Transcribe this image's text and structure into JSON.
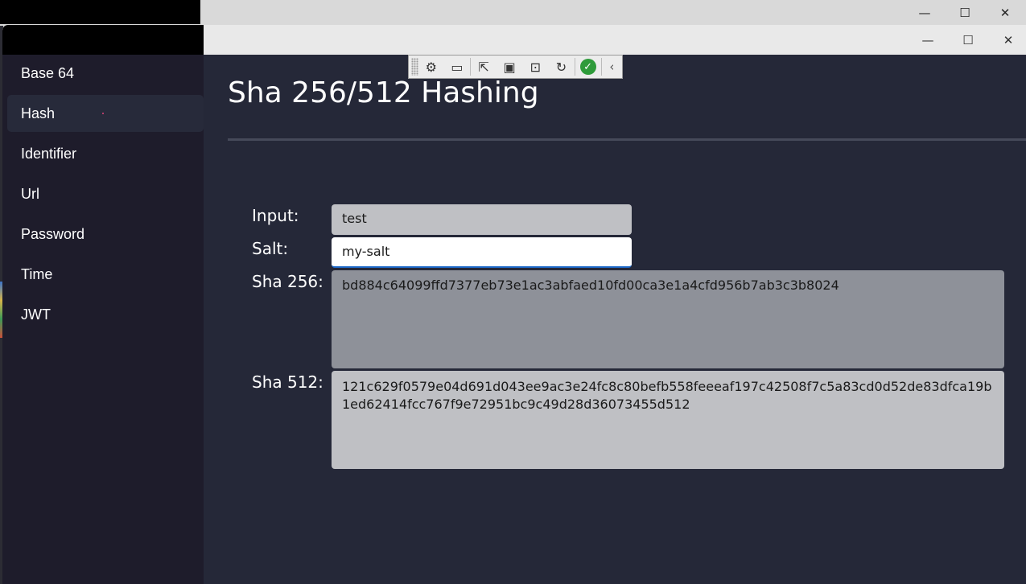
{
  "outer_window": {
    "minimize_glyph": "—",
    "maximize_glyph": "☐",
    "close_glyph": "✕"
  },
  "window": {
    "minimize_glyph": "—",
    "maximize_glyph": "☐",
    "close_glyph": "✕"
  },
  "sidebar": {
    "items": [
      {
        "label": "Base 64",
        "selected": false
      },
      {
        "label": "Hash",
        "selected": true
      },
      {
        "label": "Identifier",
        "selected": false
      },
      {
        "label": "Url",
        "selected": false
      },
      {
        "label": "Password",
        "selected": false
      },
      {
        "label": "Time",
        "selected": false
      },
      {
        "label": "JWT",
        "selected": false
      }
    ]
  },
  "main": {
    "title": "Sha 256/512 Hashing",
    "input": {
      "label": "Input:",
      "value": "test"
    },
    "salt": {
      "label": "Salt:",
      "value": "my-salt"
    },
    "sha256": {
      "label": "Sha 256:",
      "value": "bd884c64099ffd7377eb73e1ac3abfaed10fd00ca3e1a4cfd956b7ab3c3b8024"
    },
    "sha512": {
      "label": "Sha 512:",
      "value": "121c629f0579e04d691d043ee9ac3e24fc8c80befb558feeeaf197c42508f7c5a83cd0d52de83dfca19b1ed62414fcc767f9e72951bc9c49d28d36073455d512"
    }
  },
  "debug_toolbar": {
    "icons": [
      "live-visual-tree-icon",
      "record-icon",
      "select-element-icon",
      "display-layout-adorners-icon",
      "track-focus-icon",
      "hot-reload-icon",
      "binding-failures-ok-icon",
      "collapse-chevron-icon"
    ],
    "glyphs": {
      "live_visual_tree": "⚙",
      "record": "▭",
      "select_element": "⇱",
      "layout_adorners": "▣",
      "track_focus": "⊡",
      "hot_reload": "↻",
      "ok": "✓",
      "chevron": "‹"
    },
    "ok_color": "#2e9b3a"
  }
}
